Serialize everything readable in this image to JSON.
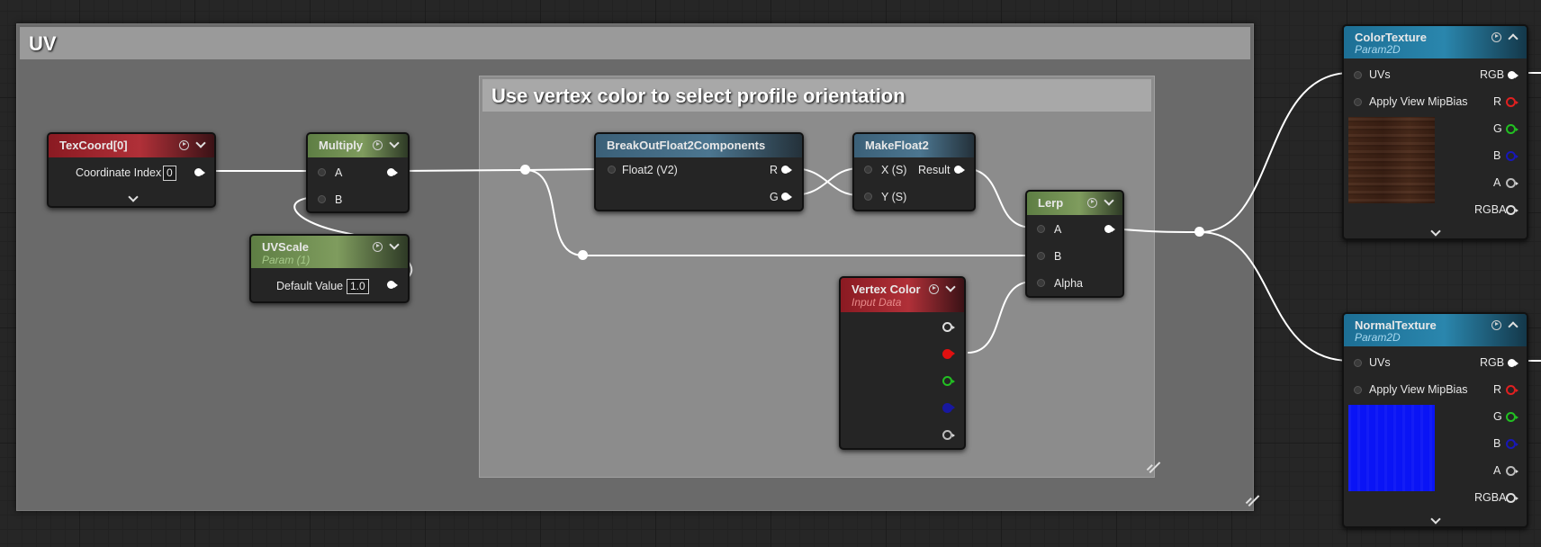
{
  "comments": {
    "uv_title": "UV",
    "inner_title": "Use vertex color to select profile orientation"
  },
  "nodes": {
    "texcoord": {
      "title": "TexCoord[0]",
      "prop_label": "Coordinate Index",
      "prop_value": "0"
    },
    "multiply": {
      "title": "Multiply",
      "pin_a": "A",
      "pin_b": "B"
    },
    "uvscale": {
      "title": "UVScale",
      "subtitle": "Param (1)",
      "prop_label": "Default Value",
      "prop_value": "1.0"
    },
    "breakout": {
      "title": "BreakOutFloat2Components",
      "input": "Float2 (V2)",
      "out_r": "R",
      "out_g": "G"
    },
    "makefloat2": {
      "title": "MakeFloat2",
      "in_x": "X (S)",
      "in_y": "Y (S)",
      "out": "Result"
    },
    "lerp": {
      "title": "Lerp",
      "in_a": "A",
      "in_b": "B",
      "in_alpha": "Alpha"
    },
    "vertexcolor": {
      "title": "Vertex Color",
      "subtitle": "Input Data"
    },
    "colortexture": {
      "title": "ColorTexture",
      "subtitle": "Param2D",
      "in_uvs": "UVs",
      "in_mip": "Apply View MipBias",
      "out_rgb": "RGB",
      "out_r": "R",
      "out_g": "G",
      "out_b": "B",
      "out_a": "A",
      "out_rgba": "RGBA"
    },
    "normaltexture": {
      "title": "NormalTexture",
      "subtitle": "Param2D",
      "in_uvs": "UVs",
      "in_mip": "Apply View MipBias",
      "out_rgb": "RGB",
      "out_r": "R",
      "out_g": "G",
      "out_b": "B",
      "out_a": "A",
      "out_rgba": "RGBA"
    }
  },
  "colors": {
    "background": "#262626",
    "wire": "#ffffff",
    "pin_red": "#e02020",
    "pin_green": "#22c022",
    "pin_blue": "#1818b8",
    "header_red": "#b03038",
    "header_green": "#7f9c5e",
    "header_blue": "#4c7690",
    "header_cyan": "#2a86ad",
    "subtitle_param": "#a6c98a",
    "subtitle_input": "#e88a8a",
    "subtitle_texture": "#a8d8ee"
  },
  "icons": [
    "preview-icon",
    "chevron-down-icon",
    "chevron-up-icon",
    "expand-icon",
    "resize-grip-icon"
  ]
}
